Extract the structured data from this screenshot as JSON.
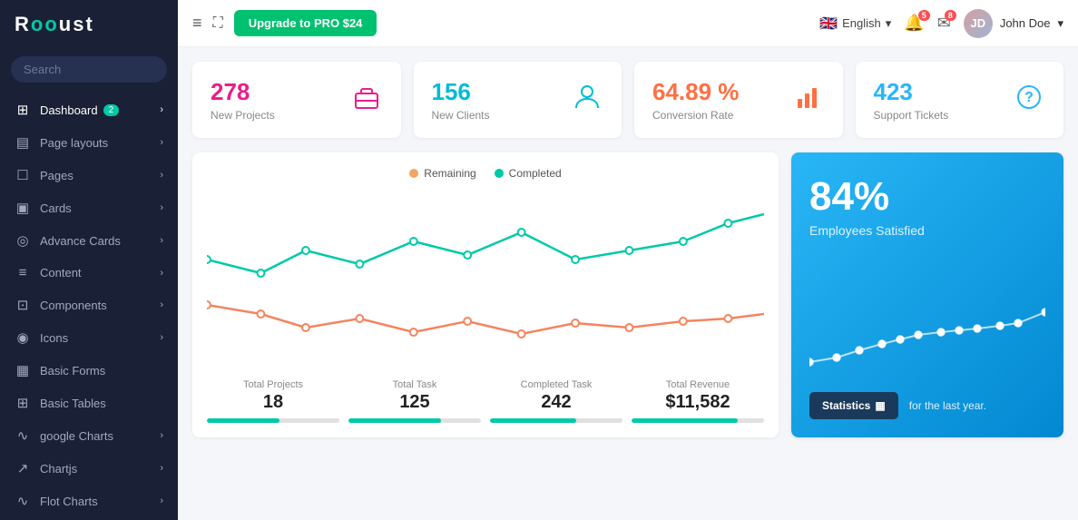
{
  "sidebar": {
    "logo": "Rooust",
    "logo_accent": "..",
    "search_placeholder": "Search",
    "items": [
      {
        "id": "dashboard",
        "icon": "⊞",
        "label": "Dashboard",
        "badge": "2",
        "arrow": "›",
        "has_badge": true
      },
      {
        "id": "page-layouts",
        "icon": "▤",
        "label": "Page layouts",
        "arrow": "›"
      },
      {
        "id": "pages",
        "icon": "☐",
        "label": "Pages",
        "arrow": "›"
      },
      {
        "id": "cards",
        "icon": "▣",
        "label": "Cards",
        "arrow": "›"
      },
      {
        "id": "advance-cards",
        "icon": "◎",
        "label": "Advance Cards",
        "arrow": "›"
      },
      {
        "id": "content",
        "icon": "≡",
        "label": "Content",
        "arrow": "›"
      },
      {
        "id": "components",
        "icon": "⊡",
        "label": "Components",
        "arrow": "›"
      },
      {
        "id": "icons",
        "icon": "◉",
        "label": "Icons",
        "arrow": "›"
      },
      {
        "id": "basic-forms",
        "icon": "▦",
        "label": "Basic Forms"
      },
      {
        "id": "basic-tables",
        "icon": "⊞",
        "label": "Basic Tables"
      },
      {
        "id": "google-charts",
        "icon": "∿",
        "label": "google Charts",
        "arrow": "›"
      },
      {
        "id": "chartjs",
        "icon": "↗",
        "label": "Chartjs",
        "arrow": "›"
      },
      {
        "id": "flot-charts",
        "icon": "∿",
        "label": "Flot Charts",
        "arrow": "›"
      }
    ]
  },
  "topbar": {
    "hamburger_icon": "≡",
    "fullscreen_icon": "⛶",
    "upgrade_btn": "Upgrade to PRO $24",
    "language": "English",
    "notif_count": "5",
    "msg_count": "8",
    "user_name": "John Doe"
  },
  "stats": [
    {
      "value": "278",
      "label": "New Projects",
      "icon": "briefcase",
      "color": "stat-pink"
    },
    {
      "value": "156",
      "label": "New Clients",
      "icon": "person",
      "color": "stat-teal"
    },
    {
      "value": "64.89 %",
      "label": "Conversion Rate",
      "icon": "chart-bar",
      "color": "stat-orange"
    },
    {
      "value": "423",
      "label": "Support Tickets",
      "icon": "question",
      "color": "stat-blue"
    }
  ],
  "chart": {
    "legend_remaining": "Remaining",
    "legend_completed": "Completed",
    "remaining_color": "#f4a460",
    "completed_color": "#00c9a7",
    "stats": [
      {
        "label": "Total Projects",
        "value": "18",
        "progress": 55
      },
      {
        "label": "Total Task",
        "value": "125",
        "progress": 70
      },
      {
        "label": "Completed Task",
        "value": "242",
        "progress": 65
      },
      {
        "label": "Total Revenue",
        "value": "$11,582",
        "progress": 80
      }
    ]
  },
  "blue_card": {
    "percentage": "84%",
    "label": "Employees Satisfied",
    "stats_btn": "Statistics",
    "year_text": "for the last year."
  }
}
